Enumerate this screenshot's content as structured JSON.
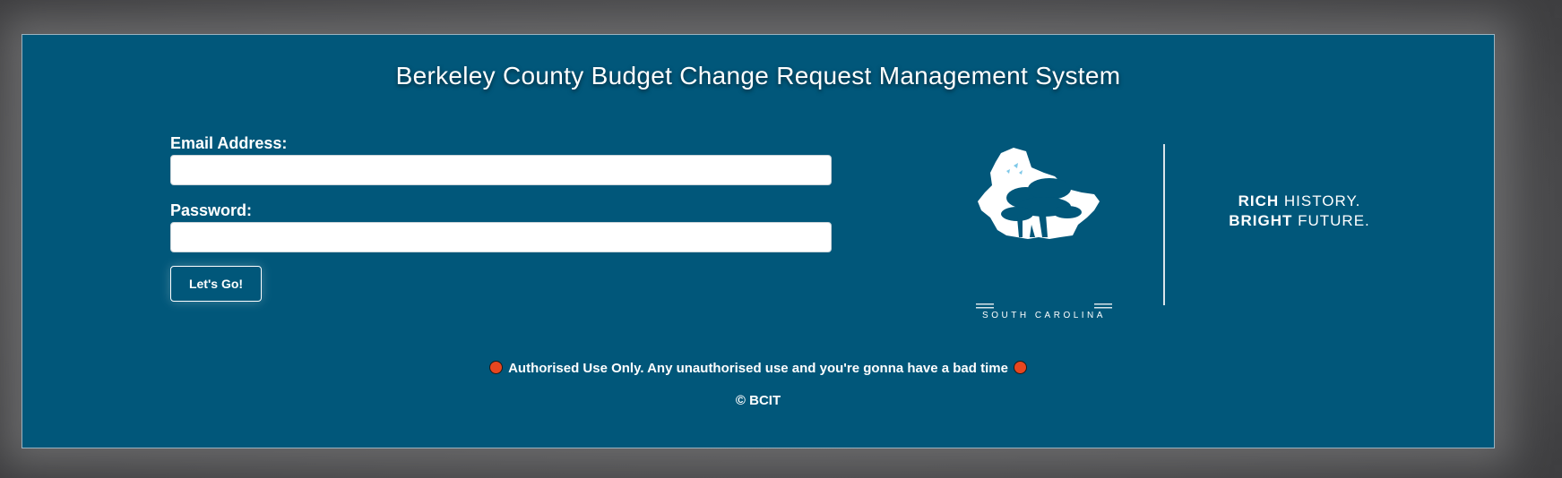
{
  "page": {
    "title": "Berkeley County Budget Change Request Management System"
  },
  "login_form": {
    "email_label": "Email Address:",
    "email_value": "",
    "password_label": "Password:",
    "password_value": "",
    "submit_label": "Let's Go!"
  },
  "branding": {
    "logo_icon": "berkeley-county-seal-icon",
    "logo_caption": "SOUTH CAROLINA",
    "tagline_line1_bold": "RICH",
    "tagline_line1_rest": " HISTORY.",
    "tagline_line2_bold": "BRIGHT",
    "tagline_line2_rest": " FUTURE."
  },
  "footer": {
    "warning_text": "Authorised Use Only. Any unauthorised use and you're gonna have a bad time",
    "warning_icon": "red-dot-icon",
    "copyright": "© BCIT"
  },
  "colors": {
    "panel_background": "#01577a",
    "warning_dot": "#e8461f",
    "text": "#ffffff"
  }
}
